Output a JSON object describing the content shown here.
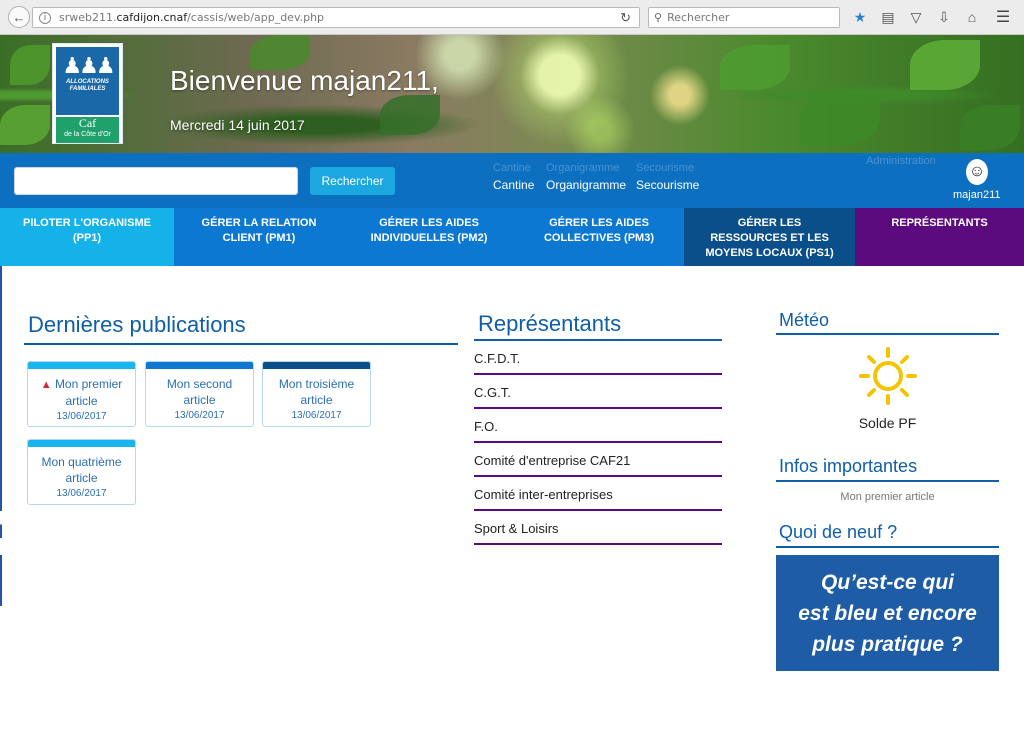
{
  "browser": {
    "url_prefix": "srweb211.",
    "url_domain": "cafdijon.cnaf",
    "url_path": "/cassis/web/app_dev.php",
    "search_placeholder": "Rechercher"
  },
  "logo": {
    "line1": "ALLOCATIONS",
    "line2": "FAMILIALES",
    "name": "Caf",
    "region": "de la Côte d'Or"
  },
  "hero": {
    "title": "Bienvenue majan211,",
    "date": "Mercredi 14 juin 2017"
  },
  "topbar": {
    "search_value": "",
    "search_button": "Rechercher",
    "quick_links": [
      "Cantine",
      "Organigramme",
      "Secourisme"
    ],
    "admin": "Administration",
    "username": "majan211"
  },
  "nav": [
    {
      "line1": "PILOTER L'ORGANISME",
      "line2": "(PP1)",
      "line3": ""
    },
    {
      "line1": "GÉRER LA RELATION",
      "line2": "CLIENT (PM1)",
      "line3": ""
    },
    {
      "line1": "GÉRER LES AIDES",
      "line2": "INDIVIDUELLES (PM2)",
      "line3": ""
    },
    {
      "line1": "GÉRER LES AIDES",
      "line2": "COLLECTIVES (PM3)",
      "line3": ""
    },
    {
      "line1": "GÉRER LES",
      "line2": "RESSOURCES ET LES",
      "line3": "MOYENS LOCAUX (PS1)"
    },
    {
      "line1": "REPRÉSENTANTS",
      "line2": "",
      "line3": ""
    }
  ],
  "publications": {
    "title": "Dernières publications",
    "cards": [
      {
        "line1": "Mon premier",
        "line2": "article",
        "date": "13/06/2017",
        "bar_color": "#19b5ee",
        "warning": true
      },
      {
        "line1": "Mon second",
        "line2": "article",
        "date": "13/06/2017",
        "bar_color": "#0d78d2",
        "warning": false
      },
      {
        "line1": "Mon troisième",
        "line2": "article",
        "date": "13/06/2017",
        "bar_color": "#0a4f89",
        "warning": false
      },
      {
        "line1": "Mon quatrième",
        "line2": "article",
        "date": "13/06/2017",
        "bar_color": "#19b5ee",
        "warning": false
      }
    ]
  },
  "representants": {
    "title": "Représentants",
    "items": [
      "C.F.D.T.",
      "C.G.T.",
      "F.O.",
      "Comité d'entreprise CAF21",
      "Comité inter-entreprises",
      "Sport & Loisirs"
    ]
  },
  "meteo": {
    "title": "Météo",
    "icon": "sun-icon",
    "label": "Solde PF"
  },
  "infos": {
    "title": "Infos importantes",
    "items": [
      "Mon premier article"
    ]
  },
  "quoi_de_neuf": {
    "title": "Quoi de neuf ?",
    "promo_line1": "Qu’est-ce qui",
    "promo_line2": "est bleu et encore",
    "promo_line3": "plus pratique ?"
  },
  "colors": {
    "brand_blue": "#0d6fc0",
    "light_blue": "#15b2ea",
    "dark_blue": "#0a4f89",
    "purple": "#5c0b7e"
  }
}
